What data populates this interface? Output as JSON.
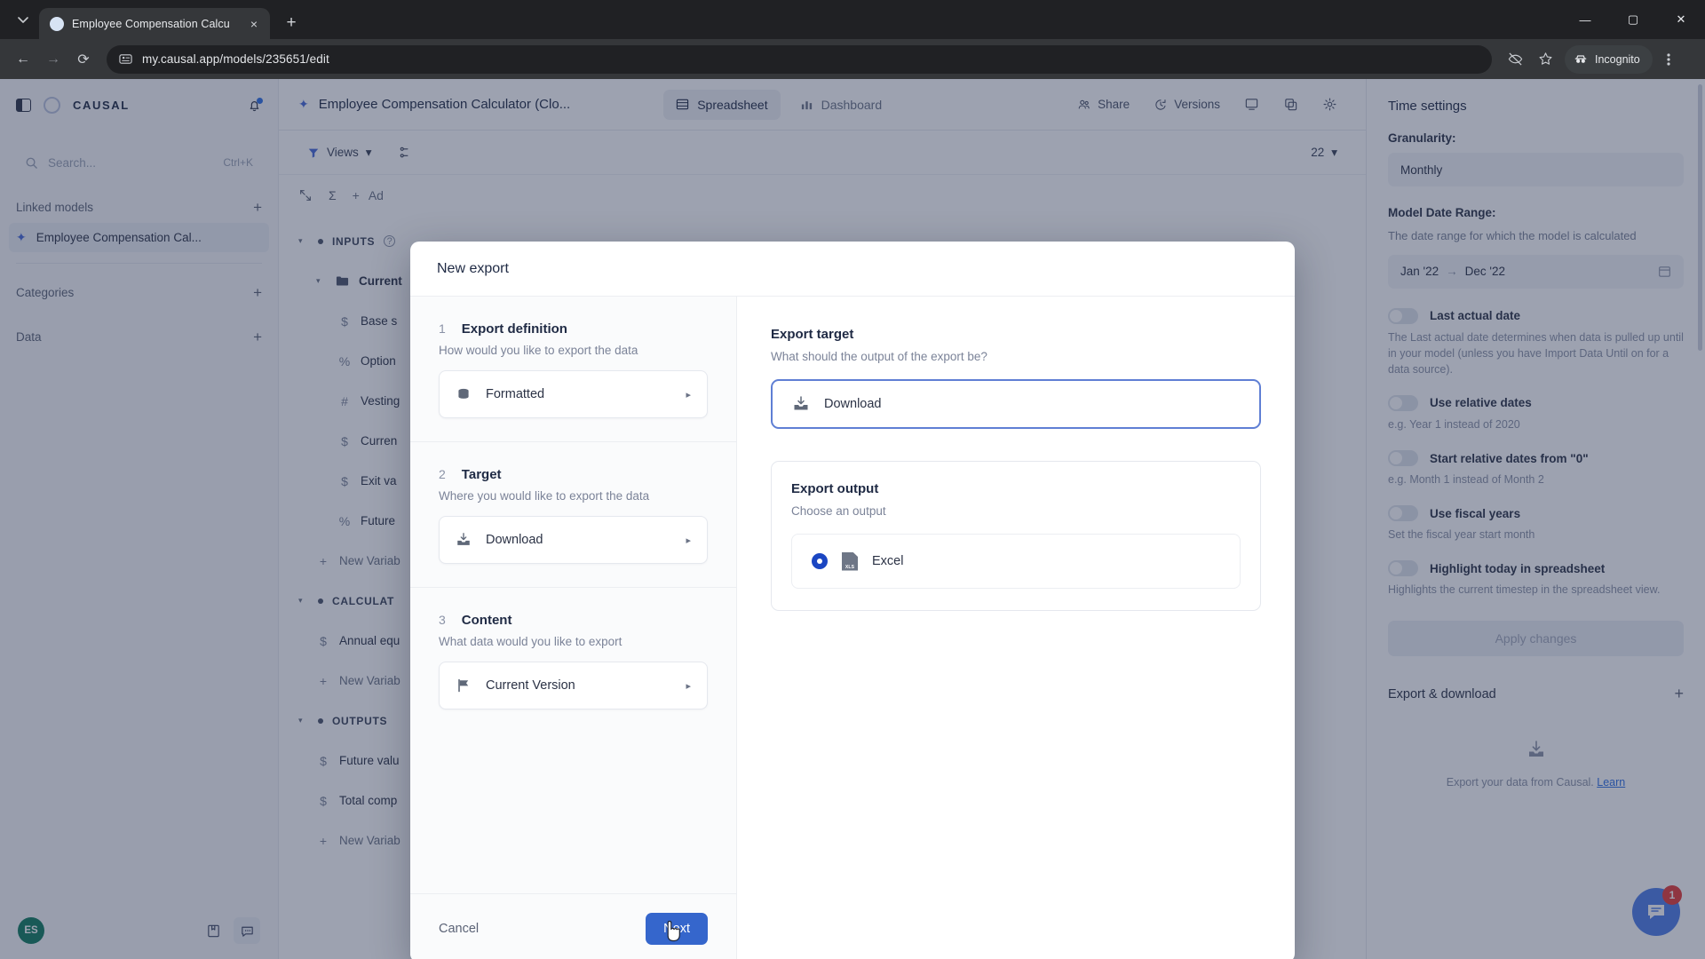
{
  "browser": {
    "tab": {
      "title": "Employee Compensation Calcu",
      "favicon": "page-icon",
      "close": "×"
    },
    "new_tab_label": "+",
    "window": {
      "minimize": "—",
      "maximize": "▢",
      "close": "✕"
    },
    "nav": {
      "back": "←",
      "forward": "→",
      "reload": "⟳"
    },
    "url": "my.causal.app/models/235651/edit",
    "site_info_icon": "permissions-icon",
    "extensions_icon": "eye-off-icon",
    "bookmark_icon": "star-icon",
    "profile": {
      "label": "Incognito",
      "icon": "incognito-icon"
    },
    "menu_icon": "kebab-menu-icon"
  },
  "sidebar": {
    "panel_toggle": "panel-toggle-icon",
    "logo": "CAUSAL",
    "notifications_icon": "bell-icon",
    "search": {
      "placeholder": "Search...",
      "shortcut": "Ctrl+K"
    },
    "sections": [
      {
        "label": "Linked models",
        "add": "+"
      },
      {
        "label": "Categories",
        "add": "+"
      },
      {
        "label": "Data",
        "add": "+"
      }
    ],
    "linked_models": [
      {
        "label": "Employee Compensation Cal...",
        "icon": "sparkle-icon"
      }
    ],
    "footer": {
      "avatar_initials": "ES",
      "docs_icon": "book-icon",
      "chat_icon": "chat-icon"
    }
  },
  "topbar": {
    "model_title": "Employee Compensation Calculator (Clo...",
    "model_icon": "sparkle-icon",
    "views": [
      {
        "label": "Spreadsheet",
        "icon": "table-icon",
        "active": true
      },
      {
        "label": "Dashboard",
        "icon": "bar-chart-icon",
        "active": false
      }
    ],
    "actions": [
      {
        "label": "Share",
        "icon": "people-icon"
      },
      {
        "label": "Versions",
        "icon": "history-icon"
      }
    ],
    "icons": [
      {
        "name": "present-icon"
      },
      {
        "name": "duplicate-icon"
      },
      {
        "name": "settings-gear-icon"
      }
    ]
  },
  "subbar": {
    "views_chip": {
      "label": "Views",
      "icon": "filter-icon",
      "caret": "▾"
    },
    "date_chip": {
      "label": "22",
      "caret": "▾"
    }
  },
  "toolrow": {
    "expand_icon": "expand-icon",
    "sum_icon": "sigma-icon",
    "add_label": "Ad"
  },
  "variables": [
    {
      "type": "group",
      "label": "INPUTS",
      "caret": "▾",
      "info": "?"
    },
    {
      "type": "folder",
      "label": "Current",
      "caret": "▾",
      "icon": "folder-icon"
    },
    {
      "type": "var",
      "label": "Base s",
      "icon": "$"
    },
    {
      "type": "var",
      "label": "Option",
      "icon": "%"
    },
    {
      "type": "var",
      "label": "Vesting",
      "icon": "#"
    },
    {
      "type": "var",
      "label": "Curren",
      "icon": "$"
    },
    {
      "type": "var",
      "label": "Exit va",
      "icon": "$"
    },
    {
      "type": "var",
      "label": "Future",
      "icon": "%"
    },
    {
      "type": "add",
      "label": "New Variab",
      "icon": "+"
    },
    {
      "type": "group",
      "label": "CALCULAT",
      "caret": "▾"
    },
    {
      "type": "var",
      "label": "Annual equ",
      "icon": "$"
    },
    {
      "type": "add",
      "label": "New Variab",
      "icon": "+"
    },
    {
      "type": "group",
      "label": "OUTPUTS",
      "caret": "▾"
    },
    {
      "type": "var",
      "label": "Future valu",
      "icon": "$"
    },
    {
      "type": "var",
      "label": "Total comp",
      "icon": "$"
    },
    {
      "type": "add",
      "label": "New Variab",
      "icon": "+"
    }
  ],
  "right_panel": {
    "title": "Time settings",
    "granularity": {
      "label": "Granularity:",
      "value": "Monthly"
    },
    "model_date_range": {
      "label": "Model Date Range:",
      "description": "The date range for which the model is calculated",
      "start": "Jan '22",
      "separator": "→",
      "end": "Dec '22",
      "calendar_icon": "calendar-icon"
    },
    "toggles": [
      {
        "label": "Last actual date",
        "description": "The Last actual date determines when data is pulled up until in your model (unless you have Import Data Until on for a data source).",
        "on": false
      },
      {
        "label": "Use relative dates",
        "description": "e.g. Year 1 instead of 2020",
        "on": false
      },
      {
        "label": "Start relative dates from \"0\"",
        "description": "e.g. Month 1 instead of Month 2",
        "on": false
      },
      {
        "label": "Use fiscal years",
        "description": "Set the fiscal year start month",
        "on": false
      },
      {
        "label": "Highlight today in spreadsheet",
        "description": "Highlights the current timestep in the spreadsheet view.",
        "on": false
      }
    ],
    "apply_button": "Apply changes",
    "export_section": {
      "label": "Export & download",
      "add": "+"
    },
    "export_empty": {
      "icon": "download-icon",
      "text": "Export your data from Causal. ",
      "link": "Learn"
    }
  },
  "fab": {
    "icon": "chat-icon",
    "badge": "1"
  },
  "modal": {
    "title": "New export",
    "steps": [
      {
        "num": "1",
        "title": "Export definition",
        "subtitle": "How would you like to export the data",
        "value": "Formatted",
        "icon": "database-icon",
        "chevron": "▸"
      },
      {
        "num": "2",
        "title": "Target",
        "subtitle": "Where you would like to export the data",
        "value": "Download",
        "icon": "download-icon",
        "chevron": "▸"
      },
      {
        "num": "3",
        "title": "Content",
        "subtitle": "What data would you like to export",
        "value": "Current Version",
        "icon": "flag-icon",
        "chevron": "▸"
      }
    ],
    "right": {
      "target_title": "Export target",
      "target_subtitle": "What should the output of the export be?",
      "target_value": "Download",
      "target_icon": "download-icon",
      "output_title": "Export output",
      "output_subtitle": "Choose an output",
      "options": [
        {
          "label": "Excel",
          "icon": "xls-file-icon",
          "selected": true,
          "icon_text": "XLS"
        }
      ]
    },
    "footer": {
      "cancel": "Cancel",
      "next": "Next"
    }
  },
  "colors": {
    "accent_blue": "#3566cc",
    "radio_blue": "#1b46c2",
    "focus_border": "#5f7fd4",
    "avatar_green": "#0f7b5e",
    "badge_red": "#e53935",
    "fab_blue": "#4e7ce8"
  }
}
